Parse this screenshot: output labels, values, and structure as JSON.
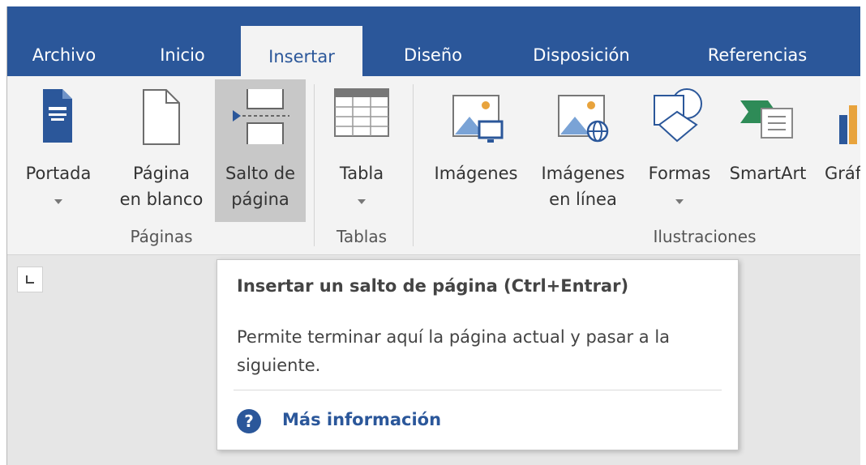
{
  "tabs": [
    "Archivo",
    "Inicio",
    "Insertar",
    "Diseño",
    "Disposición",
    "Referencias"
  ],
  "ribbon": {
    "buttons": {
      "portada": "Portada",
      "pagina_en_blanco": "Página\nen blanco",
      "salto_de_pagina": "Salto de\npágina",
      "tabla": "Tabla",
      "imagenes": "Imágenes",
      "imagenes_en_linea": "Imágenes\nen línea",
      "formas": "Formas",
      "smartart": "SmartArt",
      "grafico": "Gráf"
    },
    "groups": {
      "paginas": "Páginas",
      "tablas": "Tablas",
      "ilustraciones": "Ilustraciones"
    }
  },
  "tooltip": {
    "title": "Insertar un salto de página (Ctrl+Entrar)",
    "description": "Permite terminar aquí la página actual y pasar a la siguiente.",
    "link_label": "Más información",
    "help_icon_glyph": "?"
  },
  "colors": {
    "accent": "#2b579a",
    "ribbon_bg": "#f3f3f3",
    "highlight": "#c8c8c8"
  }
}
